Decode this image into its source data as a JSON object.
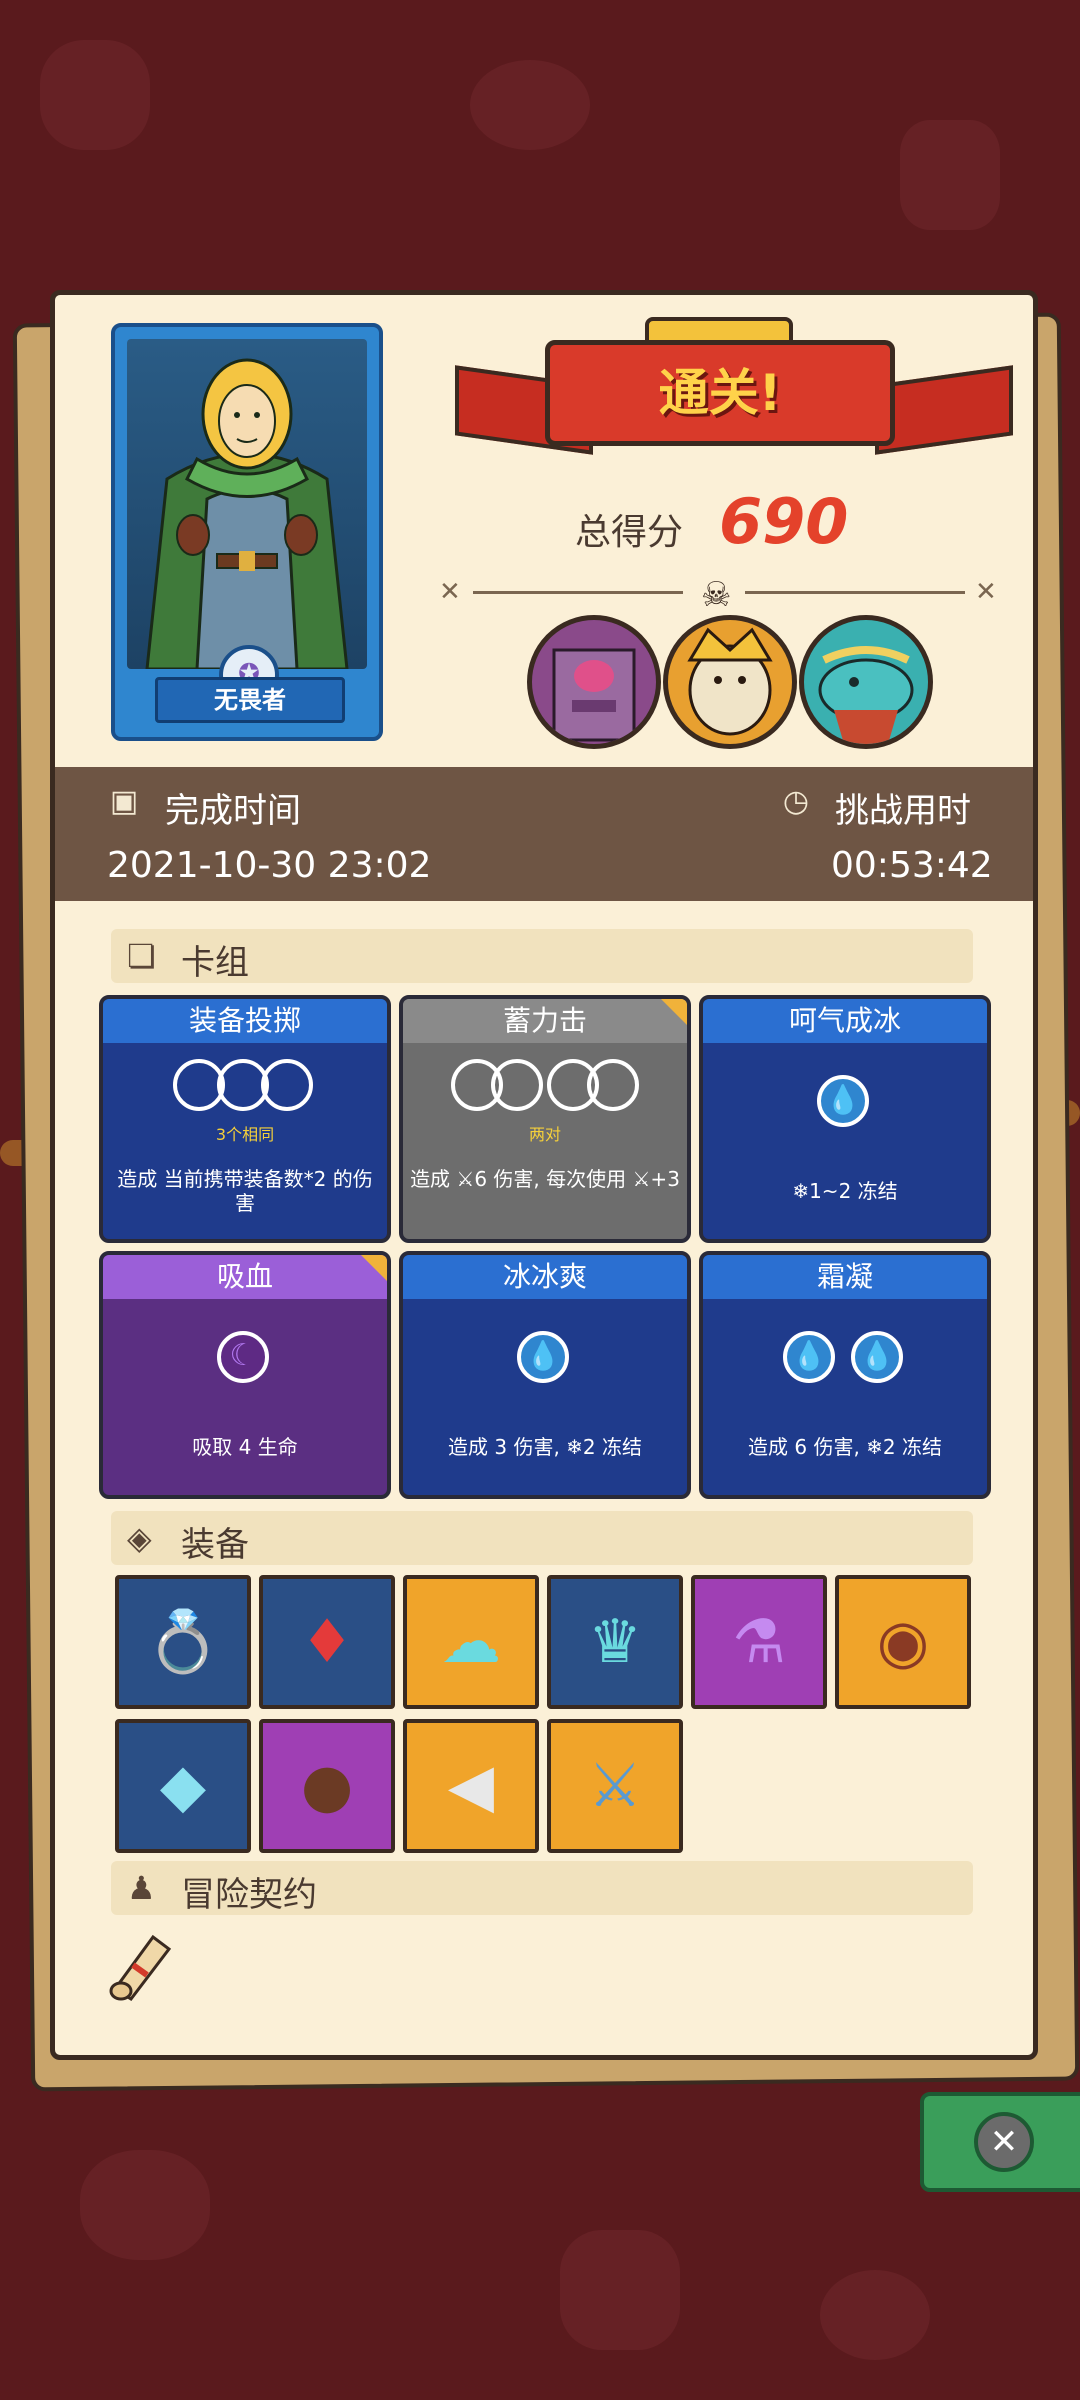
{
  "result": {
    "title": "通关!",
    "score_label": "总得分",
    "score_value": "690"
  },
  "hero": {
    "name": "无畏者"
  },
  "info": {
    "finish_label": "完成时间",
    "finish_value": "2021-10-30 23:02",
    "duration_label": "挑战用时",
    "duration_value": "00:53:42"
  },
  "deck": {
    "title": "卡组",
    "cards": [
      {
        "name": "装备投掷",
        "requirement": "3个相同",
        "description": "造成 当前携带装备数*2 的伤害"
      },
      {
        "name": "蓄力击",
        "requirement": "两对",
        "description": "造成 ⚔6 伤害, 每次使用 ⚔+3"
      },
      {
        "name": "呵气成冰",
        "requirement": "",
        "description": "❄1~2 冻结"
      },
      {
        "name": "吸血",
        "requirement": "",
        "description": "吸取 4 生命"
      },
      {
        "name": "冰冰爽",
        "requirement": "",
        "description": "造成 3 伤害, ❄2 冻结"
      },
      {
        "name": "霜凝",
        "requirement": "",
        "description": "造成 6 伤害, ❄2 冻结"
      }
    ]
  },
  "equipment": {
    "title": "装备"
  },
  "contract": {
    "title": "冒险契约"
  },
  "colors": {
    "background": "#5a1a1d",
    "panel": "#fbf0d7",
    "accent_red": "#e4422b",
    "card_blue": "#1f3b8c",
    "card_gray": "#6d6d6d",
    "card_purple": "#5b2f82"
  },
  "icons": [
    "calendar-icon",
    "stopwatch-icon",
    "cards-icon",
    "cube-icon",
    "person-icon",
    "close-icon"
  ]
}
